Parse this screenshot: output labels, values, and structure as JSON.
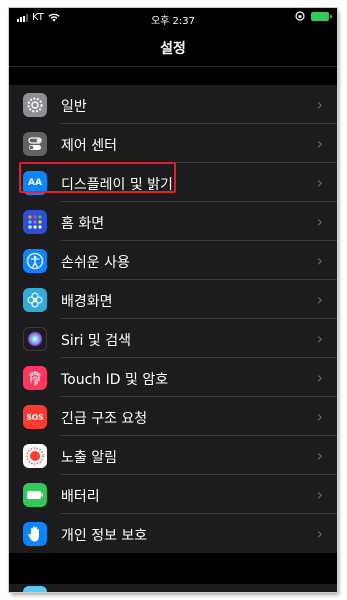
{
  "status": {
    "carrier": "KT",
    "time": "오후 2:37"
  },
  "nav": {
    "title": "설정"
  },
  "items": [
    {
      "label": "일반",
      "icon": "gear-icon",
      "color": "#8e8e93"
    },
    {
      "label": "제어 센터",
      "icon": "toggles-icon",
      "color": "#636366"
    },
    {
      "label": "디스플레이 및 밝기",
      "icon": "aa-icon",
      "color": "#0a84ff",
      "icon_text": "AA"
    },
    {
      "label": "홈 화면",
      "icon": "app-grid-icon",
      "color": "#2c4fd6"
    },
    {
      "label": "손쉬운 사용",
      "icon": "accessibility-icon",
      "color": "#0a84ff"
    },
    {
      "label": "배경화면",
      "icon": "flower-icon",
      "color": "#34aadc"
    },
    {
      "label": "Siri 및 검색",
      "icon": "siri-icon",
      "color": "#1c1c1e"
    },
    {
      "label": "Touch ID 및 암호",
      "icon": "fingerprint-icon",
      "color": "#ff375f"
    },
    {
      "label": "긴급 구조 요청",
      "icon": "sos-icon",
      "color": "#ff3b30",
      "icon_text": "SOS"
    },
    {
      "label": "노출 알림",
      "icon": "exposure-icon",
      "color": "#ff3b30"
    },
    {
      "label": "배터리",
      "icon": "battery-icon",
      "color": "#34c759"
    },
    {
      "label": "개인 정보 보호",
      "icon": "hand-icon",
      "color": "#0a84ff"
    }
  ]
}
